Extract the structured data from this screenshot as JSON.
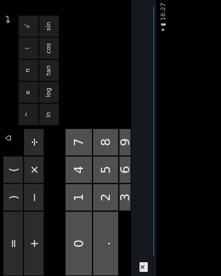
{
  "status": {
    "time": "16:27",
    "signal_icon": "signal-icon",
    "wifi_icon": "wifi-icon",
    "battery_icon": "battery-icon"
  },
  "nav": {
    "back_icon": "back-icon",
    "home_icon": "home-icon",
    "recent_icon": "recent-apps-icon"
  },
  "display": {
    "value": "",
    "clear_label": "✕"
  },
  "keys": {
    "row_numbers_top": [
      "7",
      "8",
      "9",
      "÷",
      "("
    ],
    "row_numbers_mid": [
      "4",
      "5",
      "6",
      "×",
      ")"
    ],
    "row_numbers_bot": [
      "1",
      "2",
      "3",
      "−",
      "="
    ],
    "zero": "0",
    "dot": ".",
    "plus": "+",
    "advanced_top": [
      "sin",
      "cos",
      "tan",
      "ln",
      "log"
    ],
    "advanced_bottom": [
      "!",
      "π",
      "e",
      "^",
      "√"
    ]
  }
}
